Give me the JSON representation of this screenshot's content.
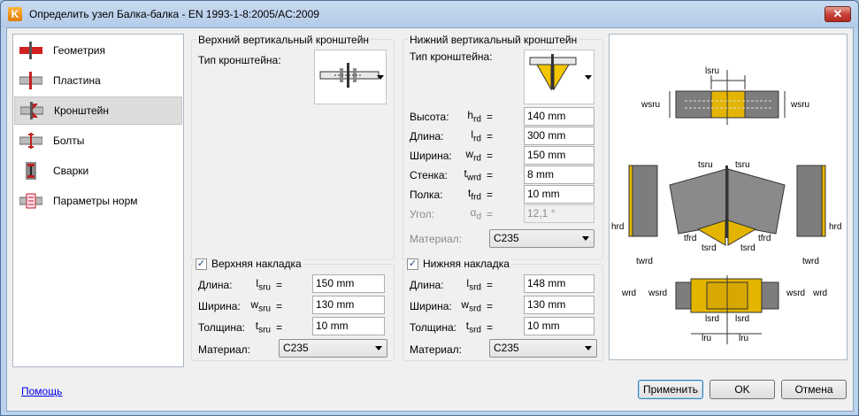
{
  "window": {
    "title": "Определить узел Балка-балка - EN 1993-1-8:2005/AC:2009",
    "app_icon_letter": "K",
    "close_glyph": "✕"
  },
  "nav": {
    "items": [
      {
        "label": "Геометрия",
        "icon": "beam-geometry-icon"
      },
      {
        "label": "Пластина",
        "icon": "plate-icon"
      },
      {
        "label": "Кронштейн",
        "icon": "bracket-icon",
        "selected": true
      },
      {
        "label": "Болты",
        "icon": "bolts-icon"
      },
      {
        "label": "Сварки",
        "icon": "welds-icon"
      },
      {
        "label": "Параметры норм",
        "icon": "code-parameters-icon"
      }
    ]
  },
  "upper_bracket": {
    "title": "Верхний вертикальный кронштейн",
    "type_label": "Тип кронштейна:"
  },
  "lower_bracket": {
    "title": "Нижний вертикальный кронштейн",
    "type_label": "Тип кронштейна:",
    "fields": [
      {
        "label": "Высота:",
        "sym": "h",
        "sub": "rd",
        "eq": "=",
        "value": "140 mm"
      },
      {
        "label": "Длина:",
        "sym": "l",
        "sub": "rd",
        "eq": "=",
        "value": "300 mm"
      },
      {
        "label": "Ширина:",
        "sym": "w",
        "sub": "rd",
        "eq": "=",
        "value": "150 mm"
      },
      {
        "label": "Стенка:",
        "sym": "t",
        "sub": "wrd",
        "eq": "=",
        "value": "8 mm"
      },
      {
        "label": "Полка:",
        "sym": "t",
        "sub": "frd",
        "eq": "=",
        "value": "10 mm"
      },
      {
        "label": "Угол:",
        "sym": "α",
        "sub": "d",
        "eq": "=",
        "value": "12,1 °",
        "disabled": true
      }
    ],
    "material_label": "Материал:",
    "material_value": "C235"
  },
  "upper_plate": {
    "checkbox_label": "Верхняя накладка",
    "checked": true,
    "fields": [
      {
        "label": "Длина:",
        "sym": "l",
        "sub": "sru",
        "eq": "=",
        "value": "150 mm"
      },
      {
        "label": "Ширина:",
        "sym": "w",
        "sub": "sru",
        "eq": "=",
        "value": "130 mm"
      },
      {
        "label": "Толщина:",
        "sym": "t",
        "sub": "sru",
        "eq": "=",
        "value": "10 mm"
      }
    ],
    "material_label": "Материал:",
    "material_value": "C235"
  },
  "lower_plate": {
    "checkbox_label": "Нижняя накладка",
    "checked": true,
    "fields": [
      {
        "label": "Длина:",
        "sym": "l",
        "sub": "srd",
        "eq": "=",
        "value": "148 mm"
      },
      {
        "label": "Ширина:",
        "sym": "w",
        "sub": "srd",
        "eq": "=",
        "value": "130 mm"
      },
      {
        "label": "Толщина:",
        "sym": "t",
        "sub": "srd",
        "eq": "=",
        "value": "10 mm"
      }
    ],
    "material_label": "Материал:",
    "material_value": "C235"
  },
  "diagram_labels": {
    "l_sru": "lsru",
    "w_sru": "wsru",
    "t_sru": "tsru",
    "h_rd": "hrd",
    "t_wrd": "twrd",
    "t_frd": "tfrd",
    "t_srd": "tsrd",
    "w_rd": "wrd",
    "w_srd": "wsrd",
    "l_srd": "lsrd",
    "l_ru": "lru"
  },
  "buttons": {
    "help": "Помощь",
    "apply": "Применить",
    "ok": "OK",
    "cancel": "Отмена"
  }
}
